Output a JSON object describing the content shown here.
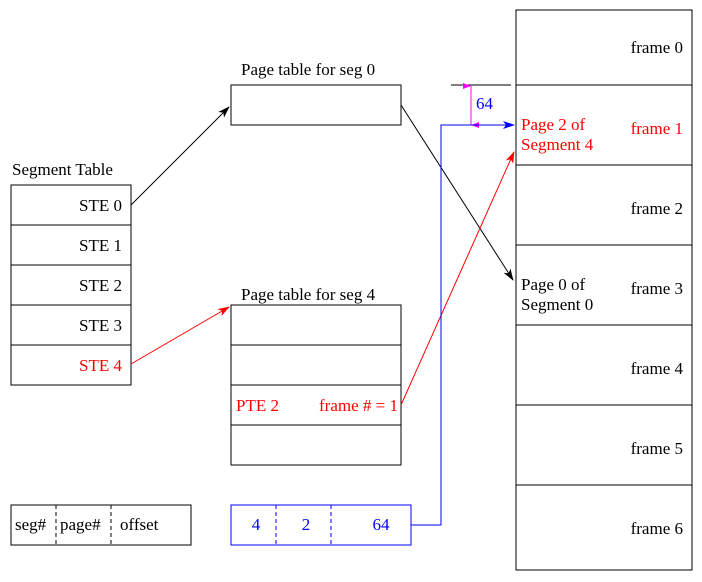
{
  "colors": {
    "black": "#000000",
    "red": "#ff0000",
    "blue": "#0000ff",
    "magenta": "#ff00ff"
  },
  "segment_table": {
    "title": "Segment Table",
    "entries": [
      "STE 0",
      "STE 1",
      "STE 2",
      "STE 3",
      "STE 4"
    ],
    "highlighted_index": 4
  },
  "page_table_seg0": {
    "title": "Page table for seg 0"
  },
  "page_table_seg4": {
    "title": "Page table for seg 4",
    "highlight_pte": "PTE 2",
    "highlight_frame": "frame # = 1"
  },
  "frames": {
    "labels": [
      "frame 0",
      "frame 1",
      "frame 2",
      "frame 3",
      "frame 4",
      "frame 5",
      "frame 6"
    ],
    "frame1_note_line1": "Page 2 of",
    "frame1_note_line2": "Segment 4",
    "frame3_note_line1": "Page 0 of",
    "frame3_note_line2": "Segment 0"
  },
  "offset_label": "64",
  "address_format": {
    "fields": [
      "seg#",
      "page#",
      "offset"
    ]
  },
  "virtual_address": {
    "fields": [
      "4",
      "2",
      "64"
    ]
  }
}
